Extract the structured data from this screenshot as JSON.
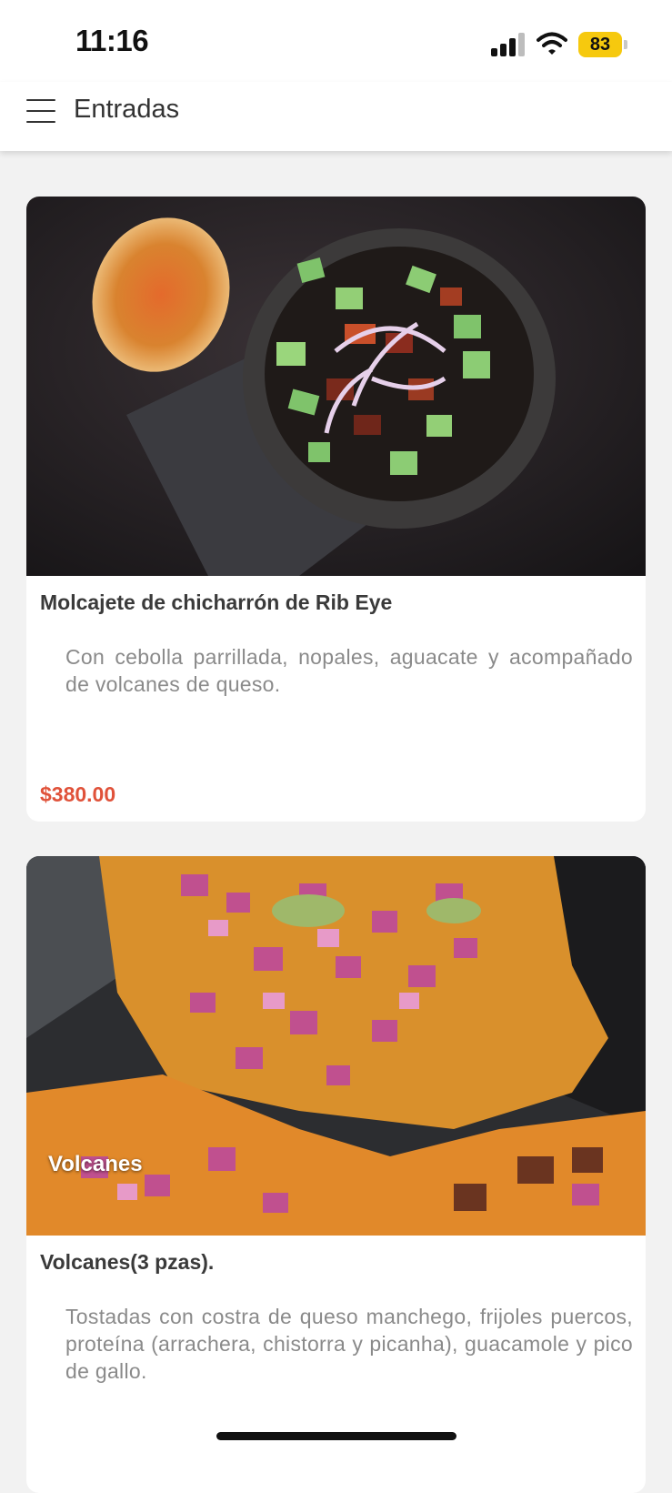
{
  "status": {
    "time": "11:16",
    "battery": "83"
  },
  "header": {
    "title": "Entradas"
  },
  "items": [
    {
      "name": "Molcajete de chicharrón de Rib Eye",
      "description": "Con cebolla parrillada, nopales, aguacate y acompañado de volcanes de queso.",
      "price": "$380.00"
    },
    {
      "name": "Volcanes(3 pzas).",
      "description": "Tostadas con costra de queso manchego, frijoles puercos, proteína (arrachera, chistorra y picanha), guacamole y pico de gallo.",
      "image_caption": "Volcanes"
    }
  ],
  "colors": {
    "price": "#e0523a",
    "battery": "#f6c90e"
  }
}
